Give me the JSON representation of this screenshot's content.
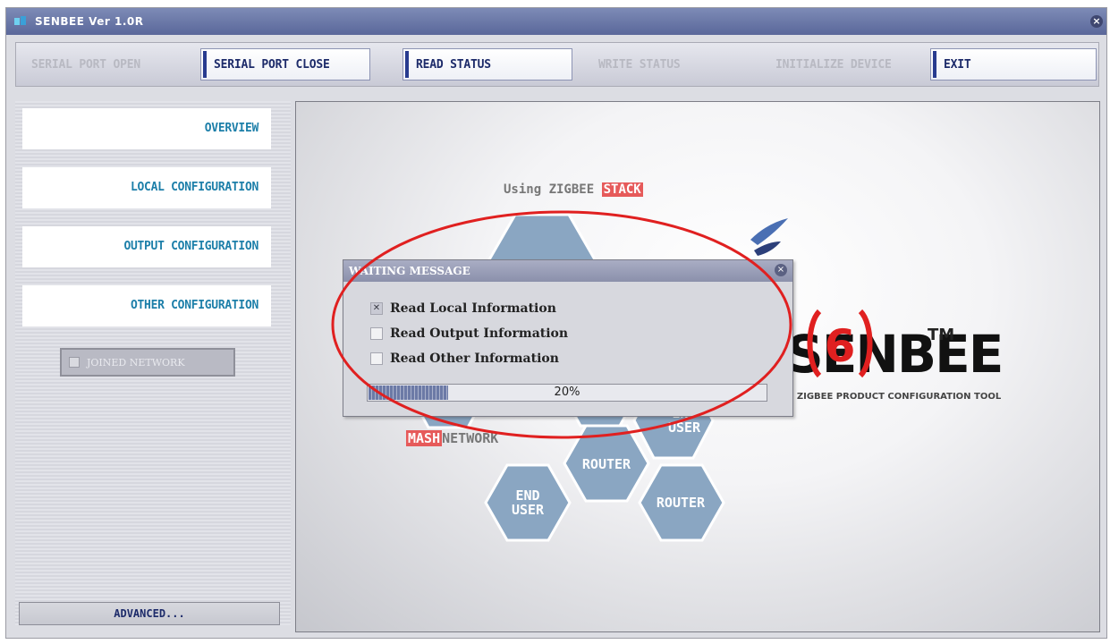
{
  "window": {
    "title": "SENBEE Ver 1.0R",
    "close_glyph": "×"
  },
  "toolbar": {
    "buttons": [
      {
        "label": "SERIAL PORT OPEN",
        "state": "disabled"
      },
      {
        "label": "SERIAL PORT CLOSE",
        "state": "active"
      },
      {
        "label": "READ STATUS",
        "state": "active"
      },
      {
        "label": "WRITE STATUS",
        "state": "disabled"
      },
      {
        "label": "INITIALIZE DEVICE",
        "state": "disabled"
      },
      {
        "label": "EXIT",
        "state": "active"
      }
    ]
  },
  "sidebar": {
    "items": [
      {
        "label": "OVERVIEW"
      },
      {
        "label": "LOCAL CONFIGURATION"
      },
      {
        "label": "OUTPUT CONFIGURATION"
      },
      {
        "label": "OTHER CONFIGURATION"
      }
    ],
    "joined_network": {
      "label": "JOINED NETWORK",
      "checked": false
    },
    "advanced_label": "ADVANCED..."
  },
  "splash": {
    "using_text": "Using ZIGBEE",
    "stack_text": "STACK",
    "mash_text": "MASH",
    "network_text": "NETWORK",
    "brand_text": "SENBEE",
    "tm_text": "TM",
    "tagline": "H ZIGBEE PRODUCT CONFIGURATION TOOL",
    "hexes": [
      {
        "label": "END\nUSER"
      },
      {
        "label": "ROUTER"
      },
      {
        "label": "END\nUSER"
      },
      {
        "label": "ROUTER"
      }
    ]
  },
  "dialog": {
    "title": "WAITING MESSAGE",
    "close_glyph": "×",
    "items": [
      {
        "label": "Read Local Information",
        "checked": true
      },
      {
        "label": "Read Output Information",
        "checked": false
      },
      {
        "label": "Read Other Information",
        "checked": false
      }
    ],
    "progress_text": "20%",
    "progress_fraction": 0.2
  },
  "annotation": {
    "number": "6",
    "color": "#e02020"
  },
  "colors": {
    "accent": "#1d7fa9",
    "toolbar_text": "#1d2b6a",
    "highlight_red": "#e65a5a",
    "hex_fill": "#8aa6c2"
  }
}
